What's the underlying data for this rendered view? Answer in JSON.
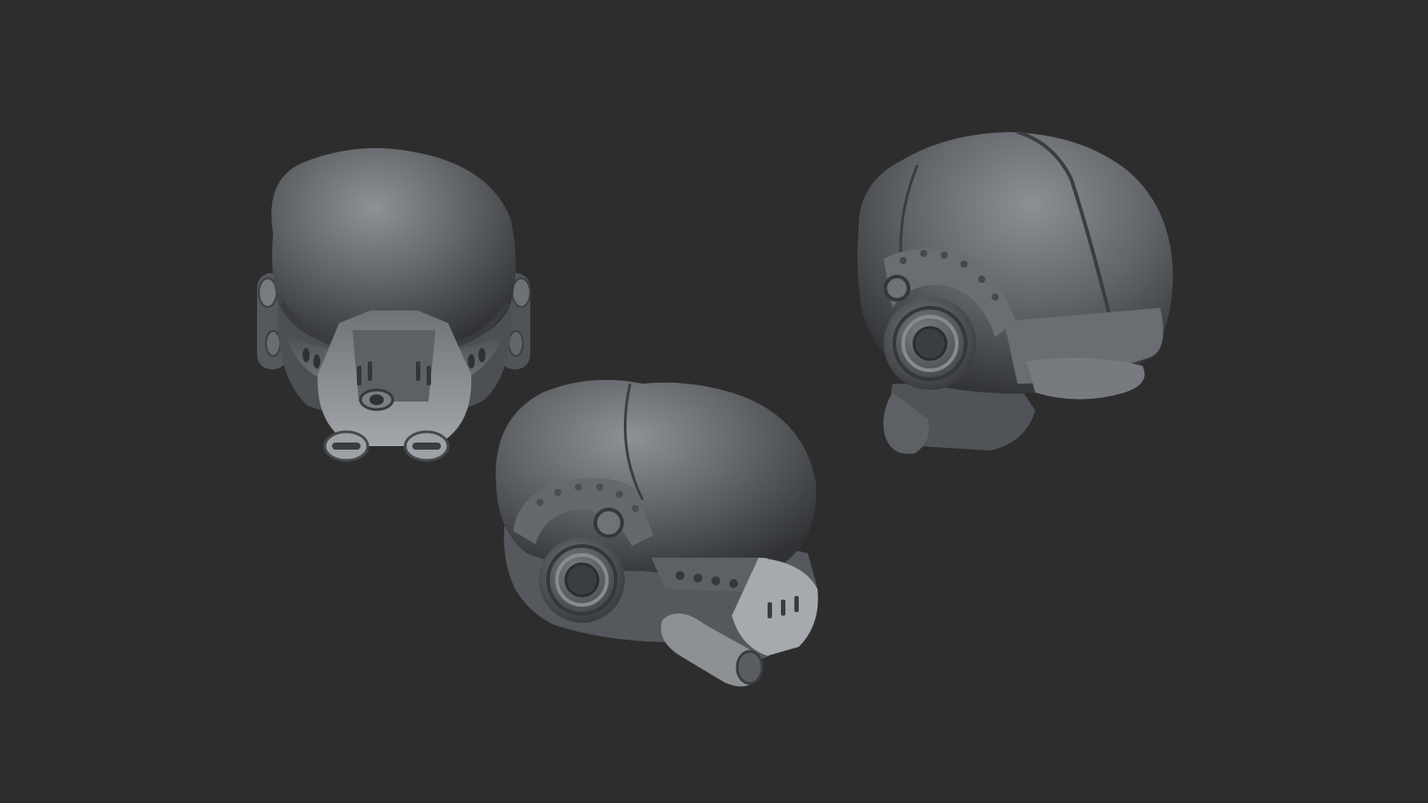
{
  "scene": {
    "background_color": "#2d2d2d",
    "material_color": "#8b8e92",
    "subject": "sculpted-helmet",
    "views": [
      {
        "id": "front",
        "label": ""
      },
      {
        "id": "side",
        "label": ""
      },
      {
        "id": "back",
        "label": ""
      }
    ]
  }
}
